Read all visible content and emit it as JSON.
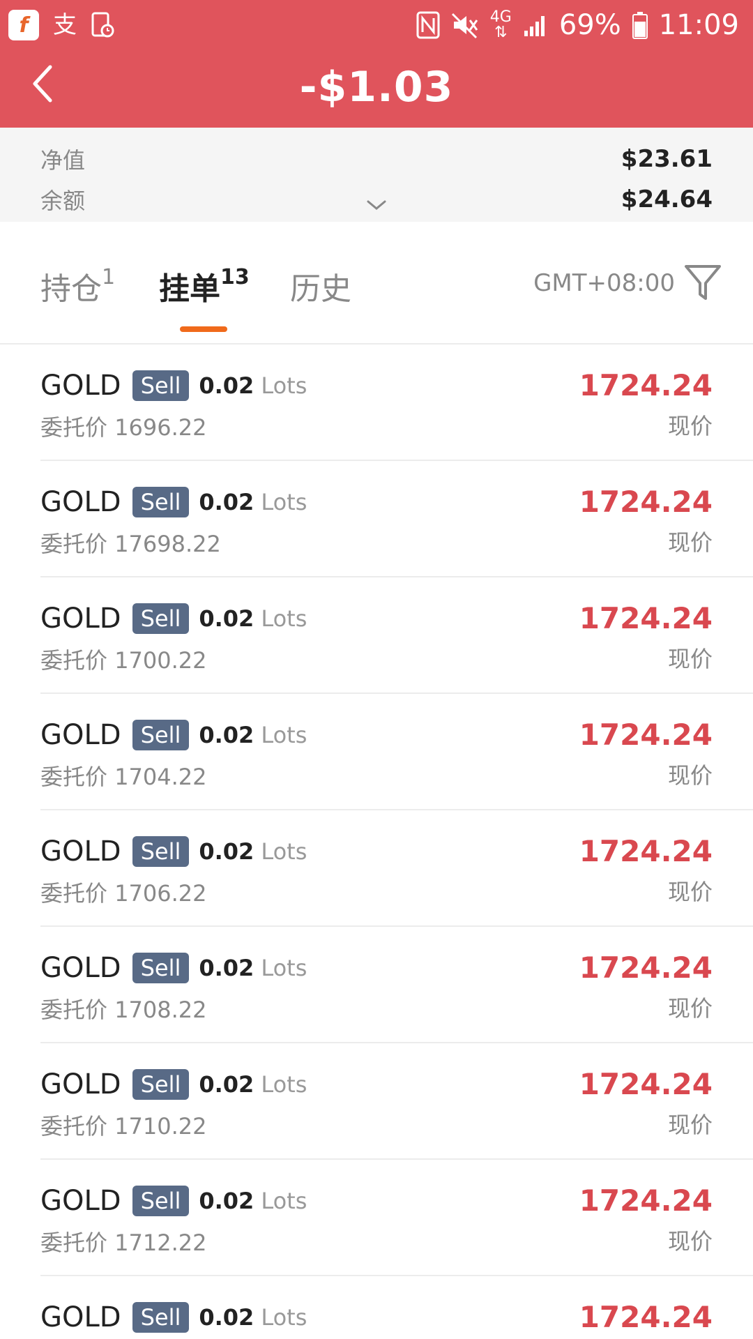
{
  "status_bar": {
    "app_glyph": "f",
    "ime_glyph": "支",
    "network": "4G",
    "battery": "69%",
    "time": "11:09"
  },
  "header": {
    "title": "-$1.03"
  },
  "summary": {
    "equity_label": "净值",
    "equity_value": "$23.61",
    "balance_label": "余额",
    "balance_value": "$24.64"
  },
  "tabs": [
    {
      "label": "持仓",
      "count": "1"
    },
    {
      "label": "挂单",
      "count": "13"
    },
    {
      "label": "历史",
      "count": ""
    }
  ],
  "timezone": "GMT+08:00",
  "orders": [
    {
      "symbol": "GOLD",
      "side": "Sell",
      "lots": "0.02",
      "lots_unit": "Lots",
      "entrust_label": "委托价",
      "entrust_price": "1696.22",
      "current_price": "1724.24",
      "current_label": "现价"
    },
    {
      "symbol": "GOLD",
      "side": "Sell",
      "lots": "0.02",
      "lots_unit": "Lots",
      "entrust_label": "委托价",
      "entrust_price": "17698.22",
      "current_price": "1724.24",
      "current_label": "现价"
    },
    {
      "symbol": "GOLD",
      "side": "Sell",
      "lots": "0.02",
      "lots_unit": "Lots",
      "entrust_label": "委托价",
      "entrust_price": "1700.22",
      "current_price": "1724.24",
      "current_label": "现价"
    },
    {
      "symbol": "GOLD",
      "side": "Sell",
      "lots": "0.02",
      "lots_unit": "Lots",
      "entrust_label": "委托价",
      "entrust_price": "1704.22",
      "current_price": "1724.24",
      "current_label": "现价"
    },
    {
      "symbol": "GOLD",
      "side": "Sell",
      "lots": "0.02",
      "lots_unit": "Lots",
      "entrust_label": "委托价",
      "entrust_price": "1706.22",
      "current_price": "1724.24",
      "current_label": "现价"
    },
    {
      "symbol": "GOLD",
      "side": "Sell",
      "lots": "0.02",
      "lots_unit": "Lots",
      "entrust_label": "委托价",
      "entrust_price": "1708.22",
      "current_price": "1724.24",
      "current_label": "现价"
    },
    {
      "symbol": "GOLD",
      "side": "Sell",
      "lots": "0.02",
      "lots_unit": "Lots",
      "entrust_label": "委托价",
      "entrust_price": "1710.22",
      "current_price": "1724.24",
      "current_label": "现价"
    },
    {
      "symbol": "GOLD",
      "side": "Sell",
      "lots": "0.02",
      "lots_unit": "Lots",
      "entrust_label": "委托价",
      "entrust_price": "1712.22",
      "current_price": "1724.24",
      "current_label": "现价"
    },
    {
      "symbol": "GOLD",
      "side": "Sell",
      "lots": "0.02",
      "lots_unit": "Lots",
      "entrust_label": "",
      "entrust_price": "",
      "current_price": "1724.24",
      "current_label": ""
    }
  ],
  "colors": {
    "header_bg": "#e0545c",
    "price_red": "#d9484f",
    "tab_indicator": "#f06a1b",
    "sell_badge": "#586a86"
  },
  "icons": {
    "back": "chevron-left-icon",
    "expand": "chevron-down-icon",
    "filter": "filter-icon",
    "nfc": "nfc-icon",
    "mute": "mute-icon",
    "signal": "signal-icon",
    "battery": "battery-icon"
  }
}
